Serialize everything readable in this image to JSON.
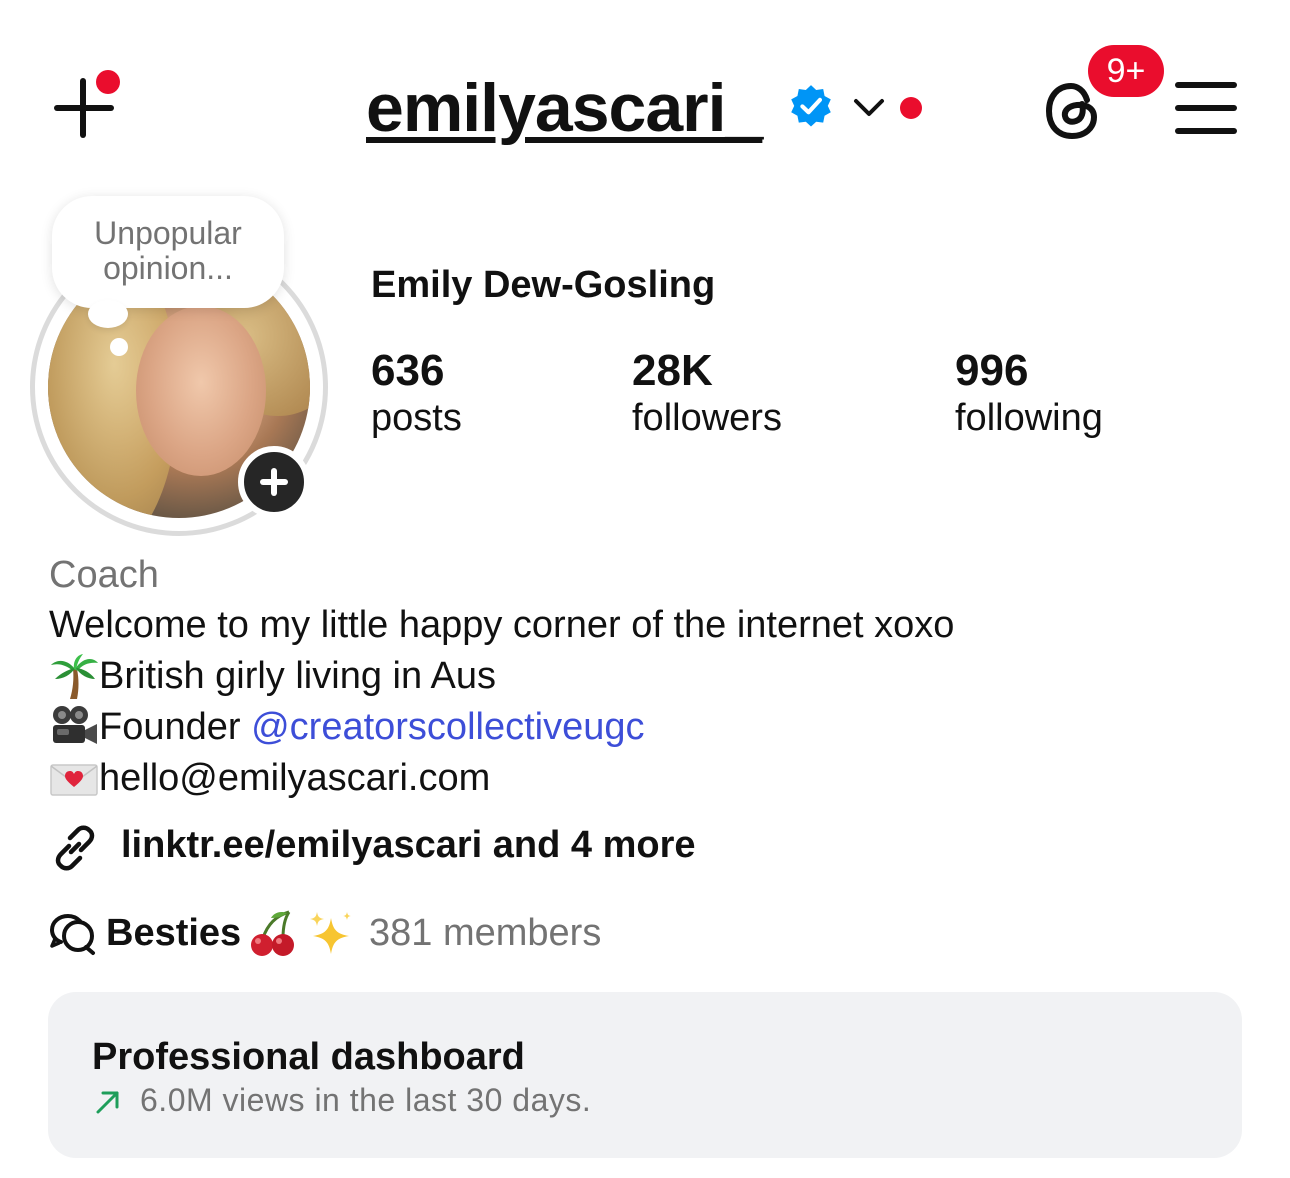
{
  "header": {
    "username": "emilyascari_",
    "threads_badge": "9+",
    "icons": {
      "create": "plus-icon",
      "verified": "verified-badge-icon",
      "account_switch": "chevron-down-icon",
      "threads": "threads-icon",
      "menu": "hamburger-menu-icon"
    }
  },
  "note": {
    "text": "Unpopular opinion..."
  },
  "profile": {
    "full_name": "Emily Dew-Gosling",
    "stats": [
      {
        "value": "636",
        "label": "posts"
      },
      {
        "value": "28K",
        "label": "followers"
      },
      {
        "value": "996",
        "label": "following"
      }
    ]
  },
  "bio": {
    "category": "Coach",
    "line1": "Welcome to my little happy corner of the internet xoxo",
    "line2": "British girly living in Aus",
    "line3_prefix": "Founder ",
    "line3_mention": "@creatorscollectiveugc",
    "line4": "hello@emilyascari.com",
    "emojis": [
      "palm-tree-emoji",
      "movie-camera-emoji",
      "love-letter-emoji"
    ]
  },
  "links": {
    "text": "linktr.ee/emilyascari and 4 more"
  },
  "channel": {
    "name": "Besties",
    "members": "381 members"
  },
  "dashboard": {
    "title": "Professional dashboard",
    "subtitle": "6.0M views in the last 30 days."
  },
  "colors": {
    "notification_red": "#ea0d2d",
    "verified_blue": "#0095f6",
    "mention_blue": "#3d4ed8",
    "secondary_text": "#737373",
    "dashboard_bg": "#f1f2f4",
    "trend_green": "#1e9e5a"
  }
}
